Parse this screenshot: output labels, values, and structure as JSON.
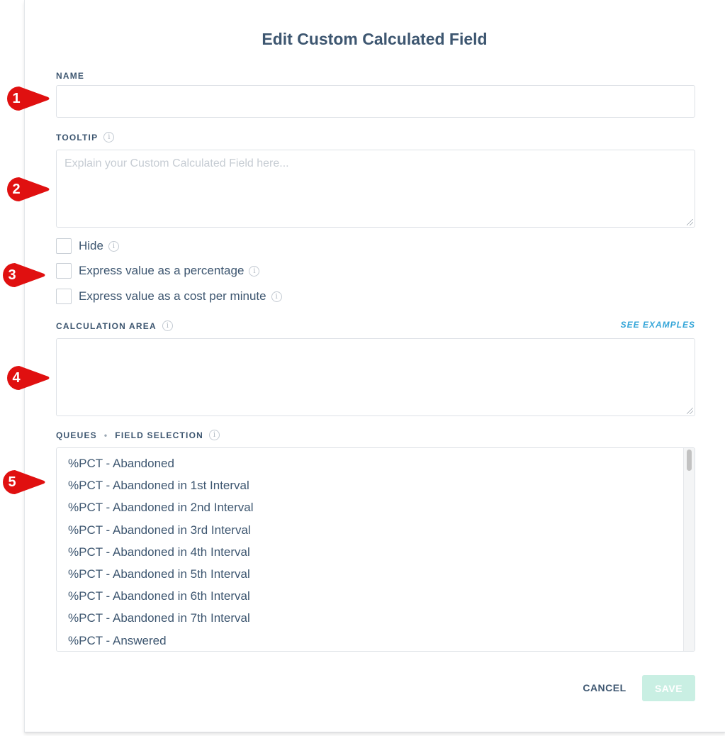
{
  "dialog": {
    "title": "Edit Custom Calculated Field"
  },
  "name_field": {
    "label": "NAME",
    "value": ""
  },
  "tooltip_field": {
    "label": "TOOLTIP",
    "value": "",
    "placeholder": "Explain your Custom Calculated Field here..."
  },
  "options": [
    {
      "label": "Hide",
      "checked": false
    },
    {
      "label": "Express value as a percentage",
      "checked": false
    },
    {
      "label": "Express value as a cost per minute",
      "checked": false
    }
  ],
  "calculation_area": {
    "label": "CALCULATION AREA",
    "value": "",
    "see_examples_label": "SEE EXAMPLES"
  },
  "field_selection": {
    "label_part1": "QUEUES",
    "separator": "•",
    "label_part2": "FIELD SELECTION",
    "items": [
      "%PCT - Abandoned",
      "%PCT - Abandoned in 1st Interval",
      "%PCT - Abandoned in 2nd Interval",
      "%PCT - Abandoned in 3rd Interval",
      "%PCT - Abandoned in 4th Interval",
      "%PCT - Abandoned in 5th Interval",
      "%PCT - Abandoned in 6th Interval",
      "%PCT - Abandoned in 7th Interval",
      "%PCT - Answered"
    ]
  },
  "footer": {
    "cancel_label": "CANCEL",
    "save_label": "SAVE"
  },
  "annotations": [
    "1",
    "2",
    "3",
    "4",
    "5"
  ],
  "icons": {
    "info": "info-circle-icon",
    "marker": "numbered-callout-arrow"
  },
  "colors": {
    "text": "#3d5670",
    "link": "#33a5d8",
    "save_disabled": "#c9efe3",
    "marker": "#e01010"
  }
}
